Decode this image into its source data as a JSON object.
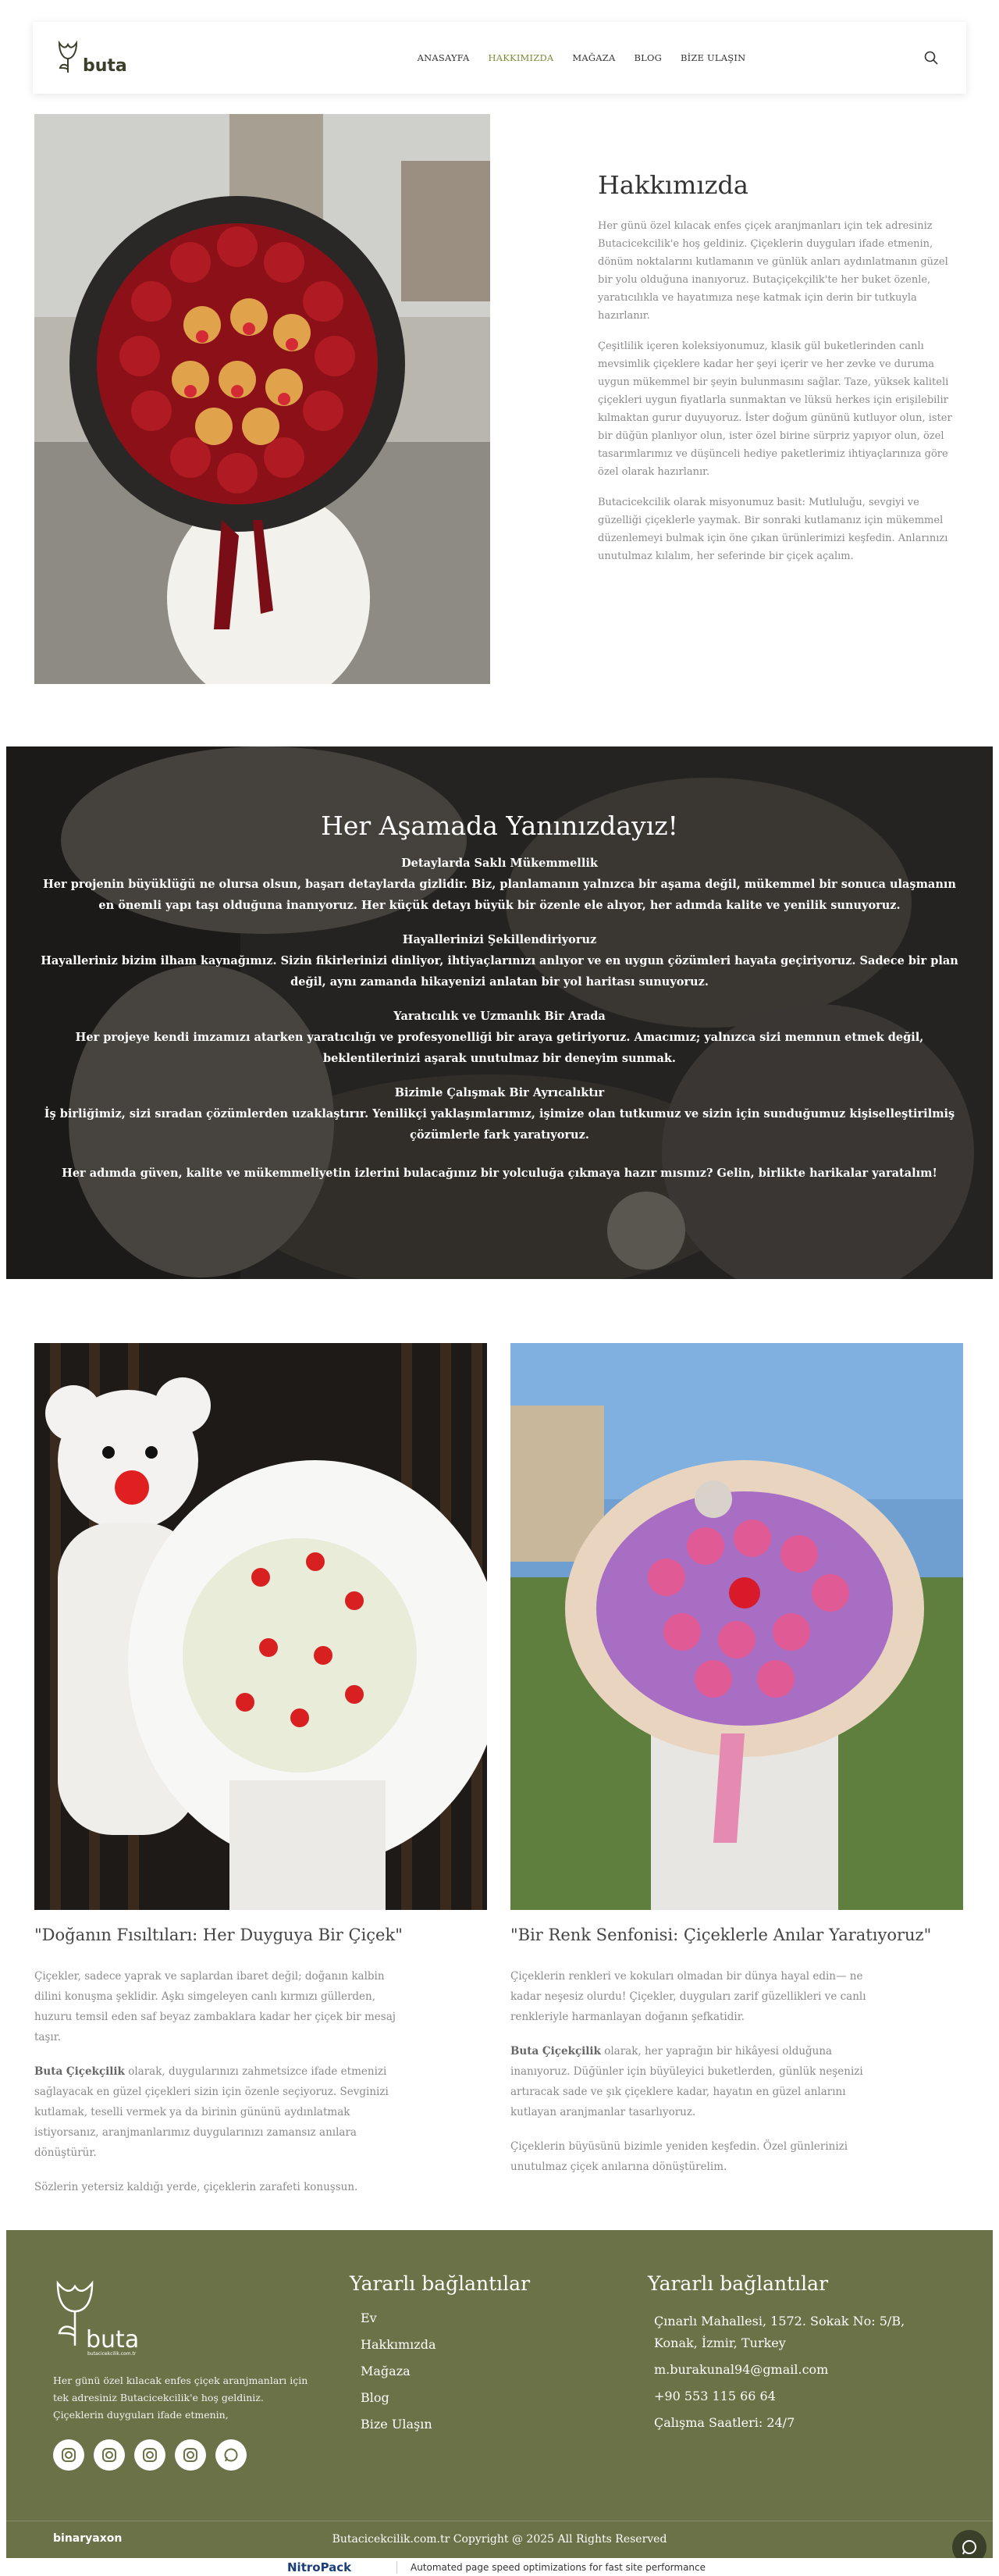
{
  "header": {
    "logo_text": "buta",
    "nav": [
      "ANASAYFA",
      "HAKKIMIZDA",
      "MAĞAZA",
      "BLOG",
      "BİZE ULAŞIN"
    ],
    "active_nav": "HAKKIMIZDA"
  },
  "about": {
    "title": "Hakkımızda",
    "paragraphs": [
      "Her günü özel kılacak enfes çiçek aranjmanları için tek adresiniz Butacicekcilik'e hoş geldiniz. Çiçeklerin duyguları ifade etmenin, dönüm noktalarını kutlamanın ve günlük anları aydınlatmanın güzel bir yolu olduğuna inanıyoruz. Butaçiçekçilik'te her buket özenle, yaratıcılıkla ve hayatımıza neşe katmak için derin bir tutkuyla hazırlanır.",
      "Çeşitlilik içeren koleksiyonumuz, klasik gül buketlerinden canlı mevsimlik çiçeklere kadar her şeyi içerir ve her zevke ve duruma uygun mükemmel bir şeyin bulunmasını sağlar. Taze, yüksek kaliteli çiçekleri uygun fiyatlarla sunmaktan ve lüksü herkes için erişilebilir kılmaktan gurur duyuyoruz. İster doğum gününü kutluyor olun, ister bir düğün planlıyor olun, ister özel birine sürpriz yapıyor olun, özel tasarımlarımız ve düşünceli hediye paketlerimiz ihtiyaçlarınıza göre özel olarak hazırlanır.",
      "Butacicekcilik olarak misyonumuz basit: Mutluluğu, sevgiyi ve güzelliği çiçeklerle yaymak. Bir sonraki kutlamanız için mükemmel düzenlemeyi bulmak için öne çıkan ürünlerimizi keşfedin. Anlarınızı unutulmaz kılalım, her seferinde bir çiçek açalım."
    ]
  },
  "banner": {
    "title": "Her Aşamada Yanınızdayız!",
    "blocks": [
      {
        "heading": "Detaylarda Saklı Mükemmellik",
        "text": "Her projenin büyüklüğü ne olursa olsun, başarı detaylarda gizlidir. Biz, planlamanın yalnızca bir aşama değil, mükemmel bir sonuca ulaşmanın en önemli yapı taşı olduğuna inanıyoruz. Her küçük detayı büyük bir özenle ele alıyor, her adımda kalite ve yenilik sunuyoruz."
      },
      {
        "heading": "Hayallerinizi Şekillendiriyoruz",
        "text": "Hayalleriniz bizim ilham kaynağımız. Sizin fikirlerinizi dinliyor, ihtiyaçlarınızı anlıyor ve en uygun çözümleri hayata geçiriyoruz. Sadece bir plan değil, aynı zamanda hikayenizi anlatan bir yol haritası sunuyoruz."
      },
      {
        "heading": "Yaratıcılık ve Uzmanlık Bir Arada",
        "text": "Her projeye kendi imzamızı atarken yaratıcılığı ve profesyonelliği bir araya getiriyoruz. Amacımız; yalnızca sizi memnun etmek değil, beklentilerinizi aşarak unutulmaz bir deneyim sunmak."
      },
      {
        "heading": "Bizimle Çalışmak Bir Ayrıcalıktır",
        "text": "İş birliğimiz, sizi sıradan çözümlerden uzaklaştırır. Yenilikçi yaklaşımlarımız, işimize olan tutkumuz ve sizin için sunduğumuz kişiselleştirilmiş çözümlerle fark yaratıyoruz."
      }
    ],
    "closing": "Her adımda güven, kalite ve mükemmeliyetin izlerini bulacağınız bir yolculuğa çıkmaya hazır mısınız? Gelin, birlikte harikalar yaratalım!"
  },
  "cards": [
    {
      "title": "\"Doğanın Fısıltıları: Her Duyguya Bir Çiçek\"",
      "p1": "Çiçekler, sadece yaprak ve saplardan ibaret değil; doğanın kalbin dilini konuşma şeklidir. Aşkı simgeleyen canlı kırmızı güllerden, huzuru temsil eden saf beyaz zambaklara kadar her çiçek bir mesaj taşır.",
      "p2_bold": "Buta Çiçekçilik",
      "p2": " olarak, duygularınızı zahmetsizce ifade etmenizi sağlayacak en güzel çiçekleri sizin için özenle seçiyoruz. Sevginizi kutlamak, teselli vermek ya da birinin gününü aydınlatmak istiyorsanız, aranjmanlarımız duygularınızı zamansız anılara dönüştürür.",
      "p3": "Sözlerin yetersiz kaldığı yerde, çiçeklerin zarafeti konuşsun."
    },
    {
      "title": "\"Bir Renk Senfonisi: Çiçeklerle Anılar Yaratıyoruz\"",
      "p1": "Çiçeklerin renkleri ve kokuları olmadan bir dünya hayal edin— ne kadar neşesiz olurdu! Çiçekler, duyguları zarif güzellikleri ve canlı renkleriyle harmanlayan doğanın şefkatidir.",
      "p2_bold": "Buta Çiçekçilik",
      "p2": " olarak, her yaprağın bir hikâyesi olduğuna inanıyoruz. Düğünler için büyüleyici buketlerden, günlük neşenizi artıracak sade ve şık çiçeklere kadar, hayatın en güzel anlarını kutlayan aranjmanlar tasarlıyoruz.",
      "p3": "Çiçeklerin büyüsünü bizimle yeniden keşfedin. Özel günlerinizi unutulmaz çiçek anılarına dönüştürelim."
    }
  ],
  "footer": {
    "logo_text": "buta",
    "logo_sub": "butacicekcilik.com.tr",
    "description": "Her günü özel kılacak enfes çiçek aranjmanları için tek adresiniz Butacicekcilik'e hoş geldiniz. Çiçeklerin duyguları ifade etmenin,",
    "social": [
      "instagram-icon",
      "instagram-icon",
      "instagram-icon",
      "instagram-icon",
      "whatsapp-icon"
    ],
    "links_title": "Yararlı bağlantılar",
    "links": [
      "Ev",
      "Hakkımızda",
      "Mağaza",
      "Blog",
      "Bize Ulaşın"
    ],
    "contact_title": "Yararlı bağlantılar",
    "address": "Çınarlı Mahallesi, 1572. Sokak No: 5/B, Konak, İzmir, Turkey",
    "email": "m.burakunal94@gmail.com",
    "phone": "+90 553 115 66 64",
    "hours": "Çalışma Saatleri: 24/7",
    "brand": "binaryaxon",
    "copyright": "Butacicekcilik.com.tr Copyright @ 2025 All Rights Reserved"
  },
  "nitro": {
    "logo": "NitroPack",
    "text": "Automated page speed optimizations for fast site performance"
  },
  "colors": {
    "accent": "#7d8a35",
    "footer_bg": "#6b7247"
  }
}
